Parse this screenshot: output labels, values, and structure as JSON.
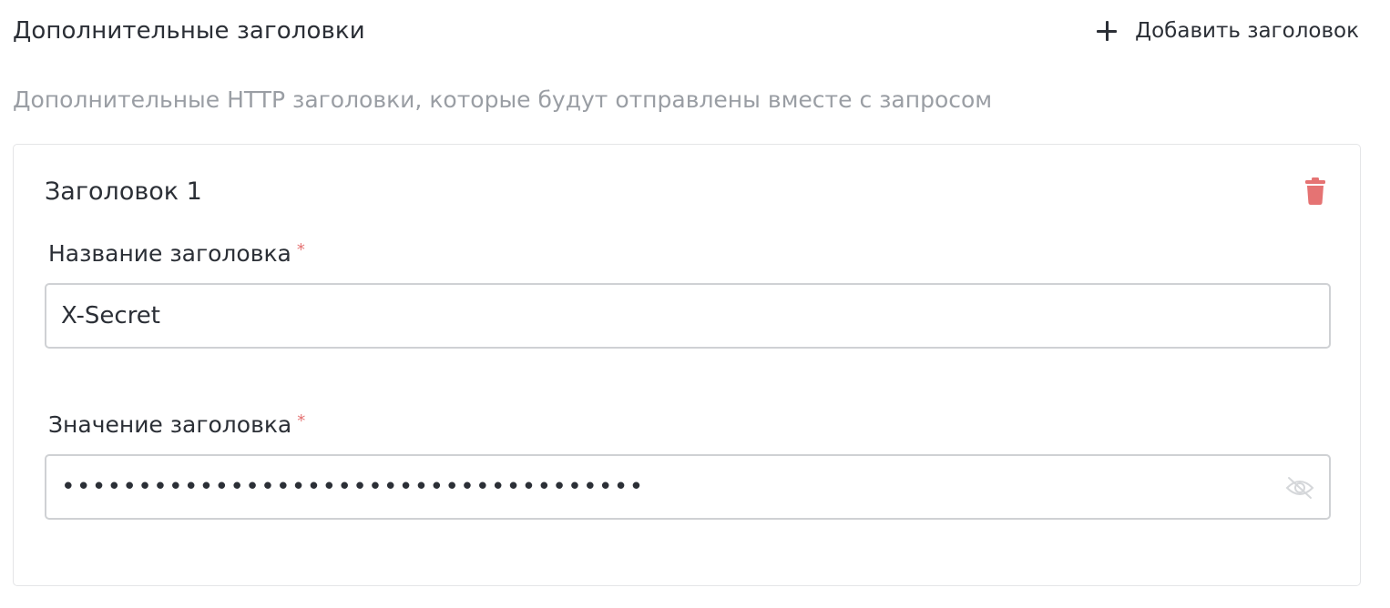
{
  "section": {
    "title": "Дополнительные заголовки",
    "add_button_label": "Добавить заголовок",
    "description": "Дополнительные HTTP заголовки, которые будут отправлены вместе с запросом"
  },
  "headers": [
    {
      "title": "Заголовок 1",
      "name_field": {
        "label": "Название заголовка",
        "required_mark": "*",
        "value": "X-Secret"
      },
      "value_field": {
        "label": "Значение заголовка",
        "required_mark": "*",
        "masked_value": "••••••••••••••••••••••••••••••••••••••",
        "visibility": "hidden"
      }
    }
  ],
  "icons": {
    "add": "plus-icon",
    "delete": "trash-icon",
    "visibility_toggle": "eye-off-icon"
  },
  "colors": {
    "text": "#2b2f36",
    "muted_text": "#9a9ea4",
    "danger": "#e57373",
    "border": "#cfd1d4"
  }
}
